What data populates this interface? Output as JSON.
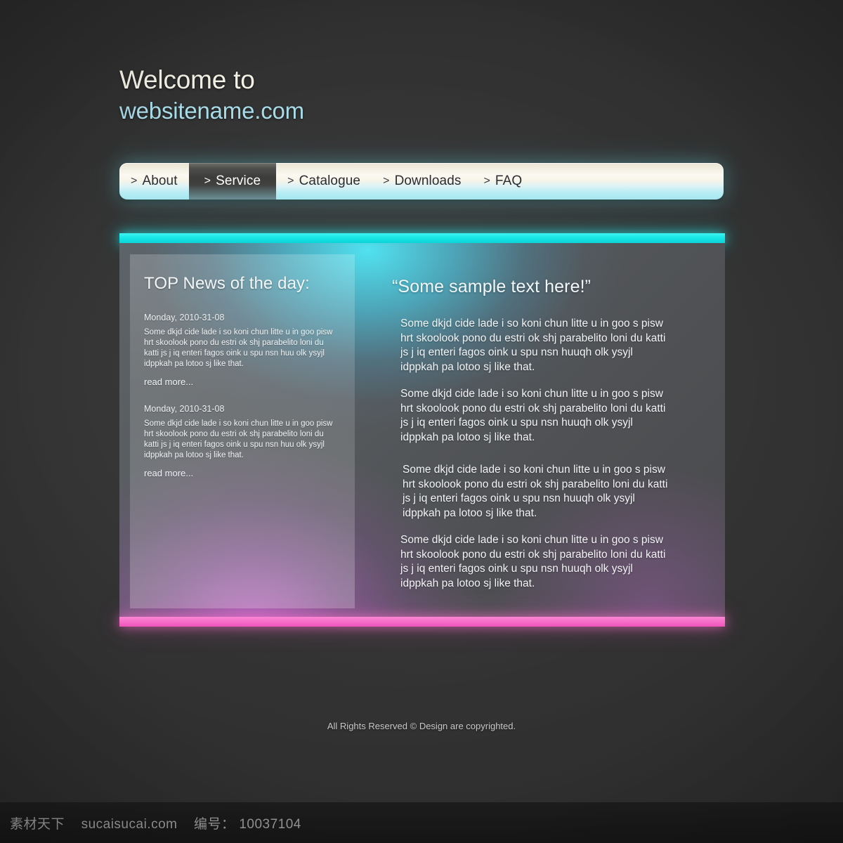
{
  "header": {
    "welcome": "Welcome to",
    "site": "websitename.com"
  },
  "nav": {
    "chevron_icon": "chevron-right",
    "items": [
      {
        "label": "About",
        "active": false
      },
      {
        "label": "Service",
        "active": true
      },
      {
        "label": "Catalogue",
        "active": false
      },
      {
        "label": "Downloads",
        "active": false
      },
      {
        "label": "FAQ",
        "active": false
      }
    ]
  },
  "panel": {
    "top_bar_color": "#15e6e6",
    "bottom_bar_color": "#f76ec8",
    "news": {
      "title": "TOP News of the day:",
      "read_more": "read more...",
      "items": [
        {
          "date": "Monday, 2010-31-08",
          "text": "Some dkjd  cide lade i so koni chun litte u in goo pisw hrt skoolook pono du estri ok shj parabelito loni du katti js j iq enteri fagos oink u spu nsn huu olk ysyjl idppkah pa lotoo sj like that.",
          "read_more": "read more..."
        },
        {
          "date": "Monday, 2010-31-08",
          "text": "Some dkjd  cide lade i so koni chun litte u in goo pisw hrt skoolook pono du estri ok shj parabelito loni du katti js j iq enteri fagos oink u spu nsn huu olk ysyjl idppkah pa lotoo sj like that.",
          "read_more": "read more..."
        }
      ]
    },
    "content": {
      "title": "“Some sample text here!”",
      "paragraphs": [
        "Some dkjd  cide lade i so koni chun litte u in goo s pisw hrt skoolook pono du estri ok shj parabelito loni du katti js j iq enteri fagos oink u spu nsn huuqh olk ysyjl idppkah pa lotoo sj like that.",
        "Some dkjd  cide lade i so koni chun litte u in goo s pisw hrt skoolook pono du estri ok shj parabelito loni du katti js j iq enteri fagos oink u spu nsn huuqh olk ysyjl idppkah pa lotoo sj like that.",
        "Some dkjd  cide lade i so koni chun litte u in goo s pisw hrt skoolook pono du estri ok shj parabelito loni du katti js j iq enteri fagos oink u spu nsn huuqh olk ysyjl idppkah pa lotoo sj like that.",
        "Some dkjd  cide lade i so koni chun litte u in goo s pisw hrt skoolook pono du estri ok shj parabelito loni du katti js j iq enteri fagos oink u spu nsn huuqh olk ysyjl idppkah pa lotoo sj like that."
      ]
    }
  },
  "footer": {
    "text": "All Rights Reserved ©  Design are copyrighted."
  },
  "watermark": {
    "brand_cn": "素材天下",
    "domain": "sucaisucai.com",
    "id_label": "编号：",
    "id_value": "10037104"
  }
}
